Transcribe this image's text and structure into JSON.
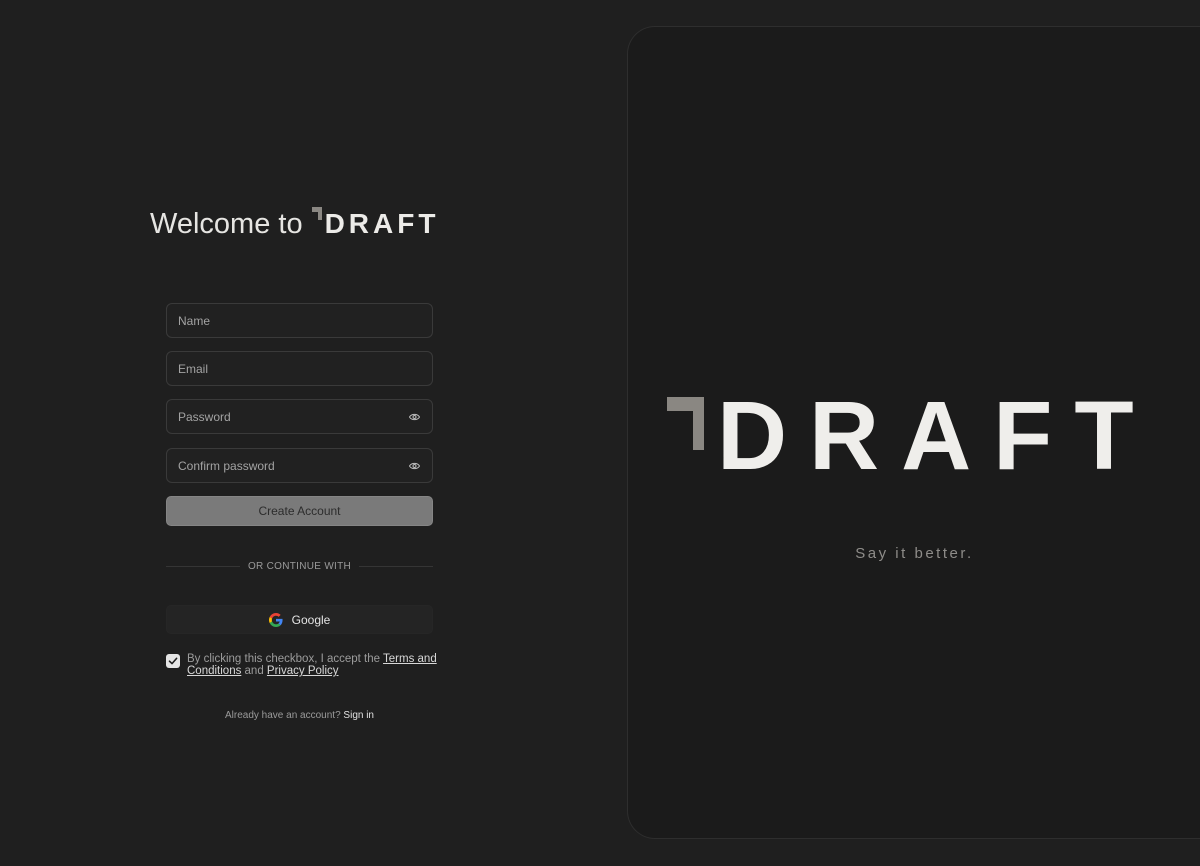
{
  "heading": {
    "prefix": "Welcome to",
    "brand": "DRAFT"
  },
  "form": {
    "name": {
      "placeholder": "Name",
      "value": ""
    },
    "email": {
      "placeholder": "Email",
      "value": ""
    },
    "password": {
      "placeholder": "Password",
      "value": "",
      "icon": "eye-icon"
    },
    "confirm_password": {
      "placeholder": "Confirm password",
      "value": "",
      "icon": "eye-icon"
    },
    "submit_label": "Create Account"
  },
  "divider_label": "OR CONTINUE WITH",
  "google": {
    "label": "Google",
    "icon": "google-icon"
  },
  "terms": {
    "checked": true,
    "text_before": "By clicking this checkbox, I accept the ",
    "terms_link": "Terms and Conditions",
    "text_middle": " and ",
    "privacy_link": "Privacy Policy"
  },
  "signin": {
    "prompt": "Already have an account?",
    "link": "Sign in"
  },
  "brand_panel": {
    "logo_text": "DRAFT",
    "tagline": "Say it better."
  },
  "colors": {
    "background": "#1f1f1f",
    "panel": "#1b1b1b",
    "logo_mark": "#8a8782",
    "button": "#7a7a7a",
    "text_primary": "#e9e9e7"
  }
}
